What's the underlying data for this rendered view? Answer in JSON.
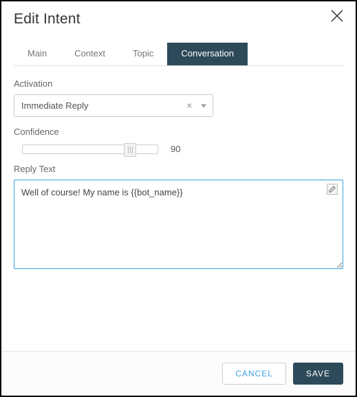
{
  "dialog": {
    "title": "Edit Intent"
  },
  "tabs": {
    "main": "Main",
    "context": "Context",
    "topic": "Topic",
    "conversation": "Conversation",
    "active": "conversation"
  },
  "fields": {
    "activation": {
      "label": "Activation",
      "value": "Immediate Reply"
    },
    "confidence": {
      "label": "Confidence",
      "value": "90"
    },
    "reply_text": {
      "label": "Reply Text",
      "value": "Well of course! My name is {{bot_name}}"
    }
  },
  "footer": {
    "cancel": "CANCEL",
    "save": "SAVE"
  }
}
